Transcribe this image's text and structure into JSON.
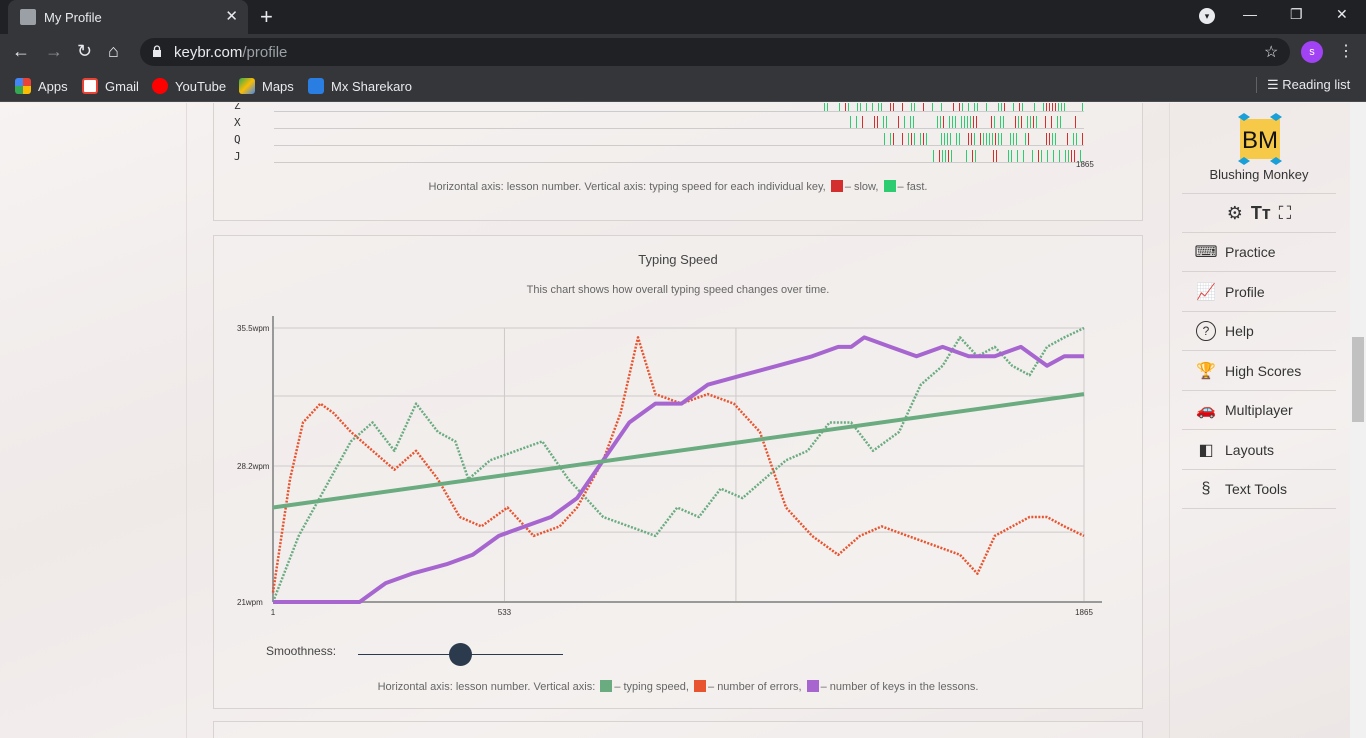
{
  "browser": {
    "tab_title": "My Profile",
    "url_host": "keybr.com",
    "url_path": "/profile",
    "avatar_letter": "s",
    "bookmarks": [
      {
        "label": "Apps",
        "icon": "apps-grid-icon"
      },
      {
        "label": "Gmail",
        "icon": "gmail-icon"
      },
      {
        "label": "YouTube",
        "icon": "youtube-icon"
      },
      {
        "label": "Maps",
        "icon": "maps-icon"
      },
      {
        "label": "Mx Sharekaro",
        "icon": "mx-sharekaro-icon"
      }
    ],
    "reading_list": "Reading list"
  },
  "key_chart": {
    "rows": [
      "Z",
      "X",
      "Q",
      "J"
    ],
    "x_end": "1865",
    "caption_prefix": "Horizontal axis: lesson number. Vertical axis: typing speed for each individual key,",
    "slow_label": "– slow,",
    "fast_label": "– fast.",
    "slow_color": "#d32f2f",
    "fast_color": "#2ecc71"
  },
  "speed_chart": {
    "title": "Typing Speed",
    "subtitle": "This chart shows how overall typing speed changes over time.",
    "smoothness_label": "Smoothness:",
    "smoothness_value": 0.5,
    "caption_prefix": "Horizontal axis: lesson number. Vertical axis:",
    "legend": [
      {
        "label": "– typing speed,",
        "color": "#6aab80"
      },
      {
        "label": "– number of errors,",
        "color": "#e8542f"
      },
      {
        "label": "– number of keys in the lessons.",
        "color": "#a766cf"
      }
    ]
  },
  "chart_data": {
    "type": "line",
    "title": "Typing Speed",
    "xlabel": "lesson number",
    "ylabel": "",
    "x_ticks": [
      "1",
      "533",
      "1865"
    ],
    "y_ticks": [
      "21wpm",
      "28.2wpm",
      "35.5wpm"
    ],
    "xlim": [
      1,
      1865
    ],
    "ylim": [
      21,
      35.5
    ],
    "series": [
      {
        "name": "typing speed",
        "color": "#6aab80",
        "x": [
          1,
          60,
          120,
          180,
          230,
          280,
          330,
          380,
          420,
          450,
          500,
          560,
          620,
          680,
          720,
          760,
          820,
          880,
          930,
          980,
          1030,
          1080,
          1130,
          1180,
          1230,
          1280,
          1330,
          1380,
          1440,
          1490,
          1540,
          1580,
          1620,
          1660,
          1700,
          1740,
          1780,
          1820,
          1865
        ],
        "y": [
          21.0,
          24.5,
          27.0,
          29.5,
          30.5,
          29.0,
          31.5,
          30.0,
          29.5,
          27.5,
          28.5,
          29.0,
          29.5,
          27.5,
          26.5,
          25.5,
          25.0,
          24.5,
          26.0,
          25.5,
          27.0,
          26.5,
          27.5,
          28.5,
          29.0,
          30.5,
          30.5,
          29.0,
          30.0,
          32.5,
          33.5,
          35.0,
          34.0,
          34.5,
          33.5,
          33.0,
          34.5,
          35.0,
          35.5
        ]
      },
      {
        "name": "number of errors",
        "color": "#e8542f",
        "x": [
          1,
          40,
          70,
          110,
          140,
          180,
          230,
          280,
          330,
          380,
          430,
          480,
          540,
          600,
          660,
          700,
          760,
          800,
          840,
          880,
          940,
          1000,
          1060,
          1120,
          1180,
          1240,
          1300,
          1350,
          1400,
          1460,
          1520,
          1580,
          1620,
          1660,
          1700,
          1740,
          1780,
          1820,
          1865
        ],
        "y": [
          21.5,
          27.5,
          30.5,
          31.5,
          31.0,
          30.0,
          29.0,
          28.0,
          29.0,
          27.5,
          25.5,
          25.0,
          26.0,
          24.5,
          25.0,
          26.0,
          28.5,
          31.0,
          35.0,
          32.0,
          31.5,
          32.0,
          31.5,
          30.0,
          26.0,
          24.5,
          23.5,
          24.5,
          25.0,
          24.5,
          24.0,
          23.5,
          22.5,
          24.5,
          25.0,
          25.5,
          25.5,
          25.0,
          24.5
        ]
      },
      {
        "name": "number of keys in the lessons",
        "color": "#a766cf",
        "x": [
          1,
          80,
          160,
          200,
          260,
          320,
          400,
          460,
          520,
          580,
          640,
          700,
          760,
          820,
          880,
          940,
          1000,
          1080,
          1160,
          1240,
          1300,
          1330,
          1360,
          1420,
          1480,
          1540,
          1600,
          1660,
          1720,
          1780,
          1820,
          1865
        ],
        "y": [
          21.0,
          21.0,
          21.0,
          21.0,
          22.0,
          22.5,
          23.0,
          23.5,
          24.5,
          25.0,
          25.5,
          26.5,
          28.5,
          30.5,
          31.5,
          31.5,
          32.5,
          33.0,
          33.5,
          34.0,
          34.5,
          34.5,
          35.0,
          34.5,
          34.0,
          34.5,
          34.0,
          34.0,
          34.5,
          33.5,
          34.0,
          34.0
        ]
      },
      {
        "name": "trend",
        "color": "#6aab80",
        "x": [
          1,
          1865
        ],
        "y": [
          26.0,
          32.0
        ]
      }
    ]
  },
  "sidebar": {
    "brand": "Blushing Monkey",
    "logo_letters": "BM",
    "items": [
      {
        "label": "Practice",
        "icon": "keyboard-icon"
      },
      {
        "label": "Profile",
        "icon": "chart-icon"
      },
      {
        "label": "Help",
        "icon": "help-icon"
      },
      {
        "label": "High Scores",
        "icon": "trophy-icon"
      },
      {
        "label": "Multiplayer",
        "icon": "car-icon"
      },
      {
        "label": "Layouts",
        "icon": "layouts-icon"
      },
      {
        "label": "Text Tools",
        "icon": "section-icon"
      }
    ]
  }
}
